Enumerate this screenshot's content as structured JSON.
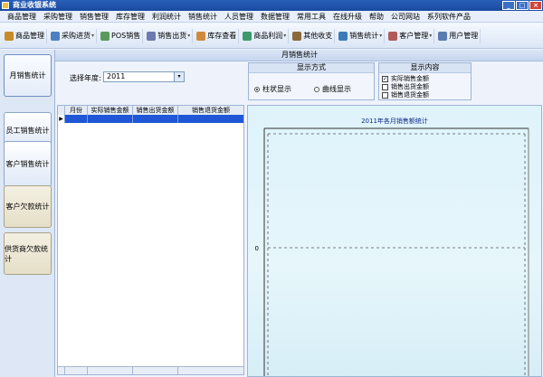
{
  "window": {
    "title": "商业收银系统"
  },
  "menu": [
    "商品管理",
    "采购管理",
    "销售管理",
    "库存管理",
    "利润统计",
    "销售统计",
    "人员管理",
    "数据管理",
    "常用工具",
    "在线升级",
    "帮助",
    "公司网站",
    "系列软件产品"
  ],
  "toolbar": [
    {
      "label": "商品管理",
      "icon": "box-icon",
      "color": "#c88a2c",
      "dropdown": false
    },
    {
      "label": "采购进货",
      "icon": "cart-icon",
      "color": "#4d7fc4",
      "dropdown": true
    },
    {
      "label": "POS销售",
      "icon": "pos-icon",
      "color": "#5a9a5a",
      "dropdown": false
    },
    {
      "label": "销售出货",
      "icon": "truck-icon",
      "color": "#6c7bb0",
      "dropdown": true
    },
    {
      "label": "库存查看",
      "icon": "warehouse-icon",
      "color": "#d08a3c",
      "dropdown": false
    },
    {
      "label": "商品利润",
      "icon": "chart-icon",
      "color": "#3c9a6c",
      "dropdown": true
    },
    {
      "label": "其他收支",
      "icon": "money-icon",
      "color": "#8a6a3c",
      "dropdown": false
    },
    {
      "label": "销售统计",
      "icon": "stats-icon",
      "color": "#3c7ab8",
      "dropdown": true
    },
    {
      "label": "客户管理",
      "icon": "customer-icon",
      "color": "#b05a5a",
      "dropdown": true
    },
    {
      "label": "用户管理",
      "icon": "user-icon",
      "color": "#5a7ab0",
      "dropdown": false
    }
  ],
  "sidebar": [
    {
      "label": "月销售统计",
      "active": true
    },
    {
      "label": "员工销售统计",
      "active": false
    },
    {
      "label": "客户销售统计",
      "active": false
    },
    {
      "label": "客户欠款统计",
      "active": false
    },
    {
      "label": "供货商欠款统计",
      "active": false
    }
  ],
  "panel": {
    "title": "月销售统计"
  },
  "filter": {
    "year_label": "选择年度:",
    "year_value": "2011"
  },
  "display_mode": {
    "title": "显示方式",
    "options": [
      {
        "label": "柱状显示",
        "selected": true
      },
      {
        "label": "曲线显示",
        "selected": false
      }
    ]
  },
  "display_content": {
    "title": "显示内容",
    "options": [
      {
        "label": "实际销售金额",
        "checked": true
      },
      {
        "label": "销售出货金额",
        "checked": false
      },
      {
        "label": "销售退货金额",
        "checked": false
      }
    ]
  },
  "table": {
    "columns": [
      "月份",
      "实际销售金额",
      "销售出货金额",
      "销售退货金额"
    ],
    "rows": [],
    "current_row_marker": "▶"
  },
  "chart_data": {
    "type": "bar",
    "title": "2011年各月销售额统计",
    "categories": [],
    "series": [],
    "y_tick_labels": [
      "0"
    ],
    "grid": true
  }
}
